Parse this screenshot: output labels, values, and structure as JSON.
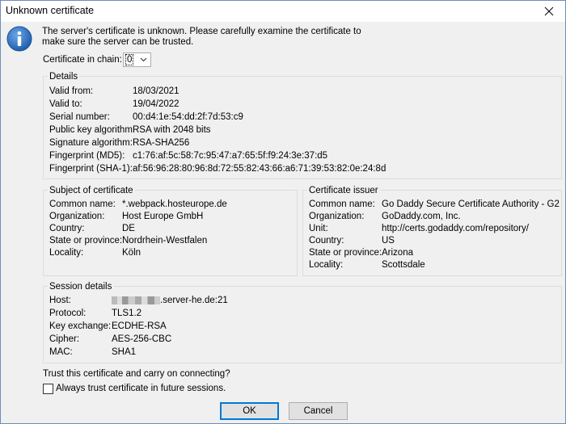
{
  "window": {
    "title": "Unknown certificate"
  },
  "message": "The server's certificate is unknown. Please carefully examine the certificate to make sure the server can be trusted.",
  "chain": {
    "label": "Certificate in chain:",
    "selected": "0"
  },
  "details": {
    "legend": "Details",
    "rows": [
      {
        "label": "Valid from:",
        "value": "18/03/2021"
      },
      {
        "label": "Valid to:",
        "value": "19/04/2022"
      },
      {
        "label": "Serial number:",
        "value": "00:d4:1e:54:dd:2f:7d:53:c9"
      },
      {
        "label": "Public key algorithm:",
        "value": "RSA with 2048 bits"
      },
      {
        "label": "Signature algorithm:",
        "value": "RSA-SHA256"
      },
      {
        "label": "Fingerprint (MD5):",
        "value": "c1:76:af:5c:58:7c:95:47:a7:65:5f:f9:24:3e:37:d5"
      },
      {
        "label": "Fingerprint (SHA-1):",
        "value": "af:56:96:28:80:96:8d:72:55:82:43:66:a6:71:39:53:82:0e:24:8d"
      }
    ]
  },
  "subject": {
    "legend": "Subject of certificate",
    "rows": [
      {
        "label": "Common name:",
        "value": "*.webpack.hosteurope.de"
      },
      {
        "label": "Organization:",
        "value": "Host Europe GmbH"
      },
      {
        "label": "Country:",
        "value": "DE"
      },
      {
        "label": "State or province:",
        "value": "Nordrhein-Westfalen"
      },
      {
        "label": "Locality:",
        "value": "Köln"
      }
    ]
  },
  "issuer": {
    "legend": "Certificate issuer",
    "rows": [
      {
        "label": "Common name:",
        "value": "Go Daddy Secure Certificate Authority - G2"
      },
      {
        "label": "Organization:",
        "value": "GoDaddy.com, Inc."
      },
      {
        "label": "Unit:",
        "value": "http://certs.godaddy.com/repository/"
      },
      {
        "label": "Country:",
        "value": "US"
      },
      {
        "label": "State or province:",
        "value": "Arizona"
      },
      {
        "label": "Locality:",
        "value": "Scottsdale"
      }
    ]
  },
  "session": {
    "legend": "Session details",
    "rows": [
      {
        "label": "Host:",
        "value": ".server-he.de:21"
      },
      {
        "label": "Protocol:",
        "value": "TLS1.2"
      },
      {
        "label": "Key exchange:",
        "value": "ECDHE-RSA"
      },
      {
        "label": "Cipher:",
        "value": "AES-256-CBC"
      },
      {
        "label": "MAC:",
        "value": "SHA1"
      }
    ]
  },
  "trust_question": "Trust this certificate and carry on connecting?",
  "always_trust_label": "Always trust certificate in future sessions.",
  "buttons": {
    "ok": "OK",
    "cancel": "Cancel"
  },
  "icons": {
    "info": "info-icon",
    "close": "close-icon"
  },
  "colors": {
    "accent": "#0078d7",
    "icon_blue": "#1f5fae"
  }
}
